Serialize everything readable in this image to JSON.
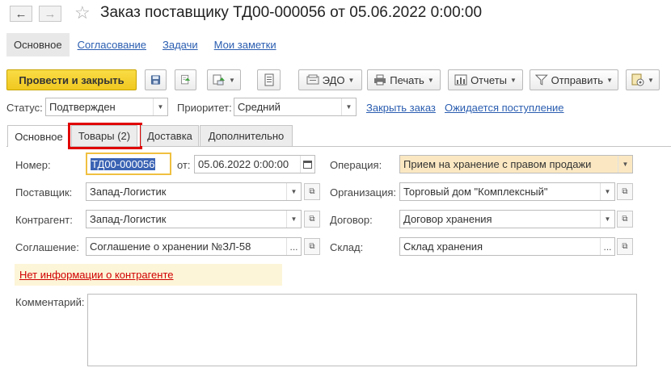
{
  "window": {
    "title": "Заказ поставщику ТД00-000056 от 05.06.2022 0:00:00"
  },
  "nav": {
    "sections": [
      "Основное",
      "Согласование",
      "Задачи",
      "Мои заметки"
    ]
  },
  "toolbar": {
    "post_close_label": "Провести и закрыть",
    "edo_label": "ЭДО",
    "print_label": "Печать",
    "reports_label": "Отчеты",
    "send_label": "Отправить"
  },
  "header": {
    "status_label": "Статус:",
    "status_value": "Подтвержден",
    "priority_label": "Приоритет:",
    "priority_value": "Средний",
    "close_order_link": "Закрыть заказ",
    "expected_link": "Ожидается поступление"
  },
  "tabs": [
    "Основное",
    "Товары (2)",
    "Доставка",
    "Дополнительно"
  ],
  "form": {
    "number_label": "Номер:",
    "number_value": "ТД00-000056",
    "from_label": "от:",
    "date_value": "05.06.2022  0:00:00",
    "operation_label": "Операция:",
    "operation_value": "Прием на хранение с правом продажи",
    "supplier_label": "Поставщик:",
    "supplier_value": "Запад-Логистик",
    "organization_label": "Организация:",
    "organization_value": "Торговый дом \"Комплексный\"",
    "counterparty_label": "Контрагент:",
    "counterparty_value": "Запад-Логистик",
    "contract_label": "Договор:",
    "contract_value": "Договор хранения",
    "agreement_label": "Соглашение:",
    "agreement_value": "Соглашение о хранении №ЗЛ-58",
    "warehouse_label": "Склад:",
    "warehouse_value": "Склад хранения",
    "no_info_link": "Нет информации о контрагенте",
    "comment_label": "Комментарий:",
    "comment_value": ""
  },
  "colors": {
    "accent_yellow": "#f5d22e",
    "link": "#2a5db0",
    "warning_link": "#d00000",
    "operation_bg": "#fbe8c2",
    "highlight_border": "#e00000",
    "info_bg": "#fdf5d8"
  }
}
